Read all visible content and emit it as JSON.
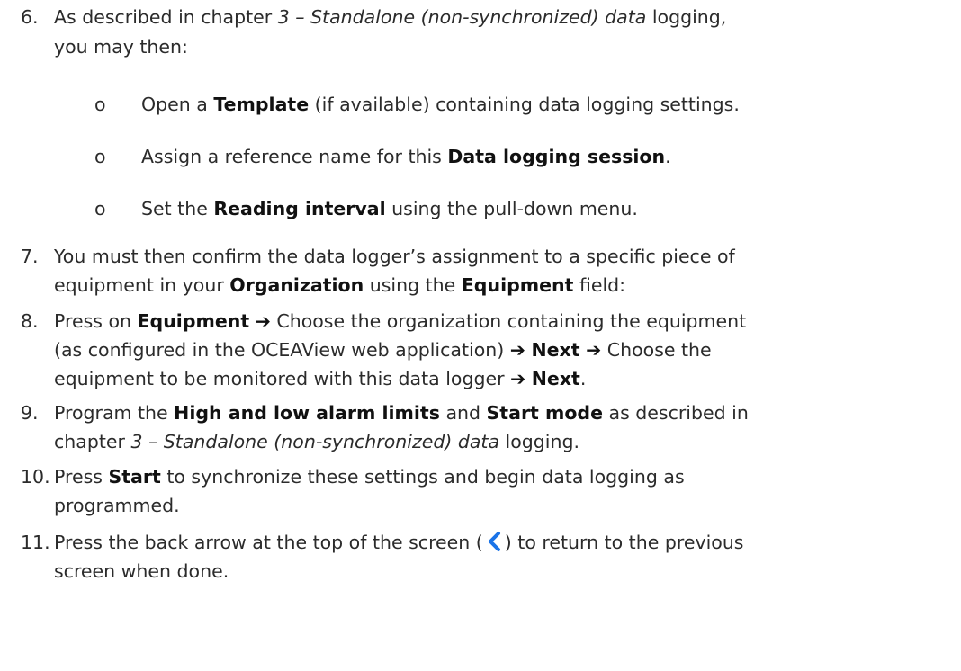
{
  "items": [
    {
      "number": "6.",
      "intro_a": "As described in chapter ",
      "intro_ref": "3 – Standalone (non-synchronized) data",
      "intro_b": " logging,",
      "intro_c": "you may then:",
      "subitems": [
        {
          "bullet": "o",
          "a": "Open a ",
          "bold": "Template",
          "b": " (if available) containing data logging settings."
        },
        {
          "bullet": "o",
          "a": "Assign a reference name for this ",
          "bold": "Data logging session",
          "b": "."
        },
        {
          "bullet": "o",
          "a": "Set the ",
          "bold": "Reading interval",
          "b": " using the pull-down menu."
        }
      ]
    },
    {
      "number": "7.",
      "t1": "You must then confirm the data logger’s assignment to a specific piece of",
      "t2": "equipment in your ",
      "b1": "Organization",
      "t3": " using the ",
      "b2": "Equipment",
      "t4": " field:"
    },
    {
      "number": "8.",
      "t1": "Press on ",
      "b1": "Equipment",
      "arrow": "➔",
      "t2": " Choose the organization containing the equipment",
      "t3": "(as configured in the OCEAView web application) ",
      "b2": "Next",
      "t4": " Choose the",
      "t5": "equipment to be monitored with this data logger ",
      "b3": "Next",
      "t6": "."
    },
    {
      "number": "9.",
      "t1": "Program the ",
      "b1": "High and low alarm limits",
      "t2": " and ",
      "b2": "Start mode",
      "t3": " as described in",
      "t4": "chapter ",
      "ref": "3 – Standalone (non-synchronized) data",
      "t5": " logging."
    },
    {
      "number": "10.",
      "t1": "Press ",
      "b1": "Start",
      "t2": " to synchronize these settings and begin data logging as",
      "t3": "programmed."
    },
    {
      "number": "11.",
      "t1": "Press the back arrow at the top of the screen (",
      "icon": "chevron-left-icon",
      "t2": ") to return to the previous",
      "t3": "screen when done."
    }
  ],
  "colors": {
    "text": "#2b2b2b",
    "bold": "#111111",
    "back_arrow": "#1a73e8"
  }
}
